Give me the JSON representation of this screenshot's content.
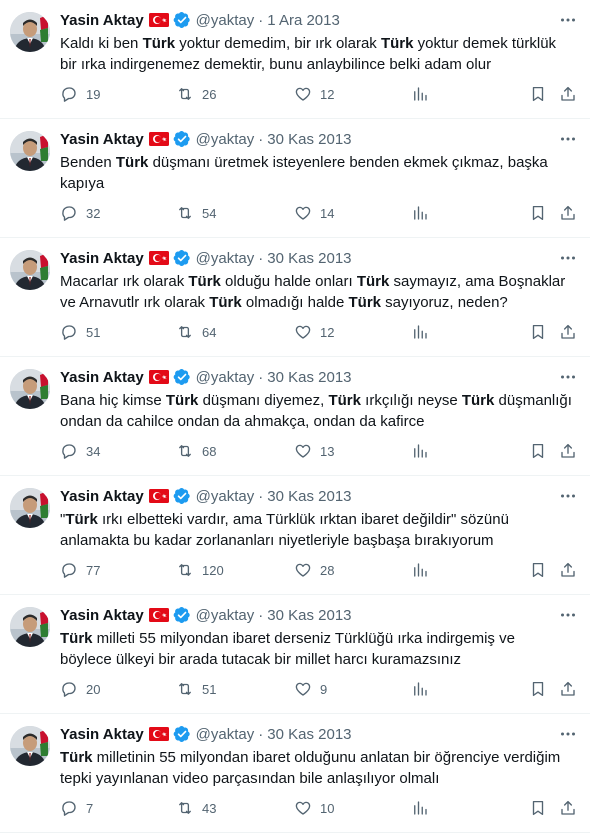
{
  "colors": {
    "text": "#0f1419",
    "secondary": "#536471",
    "verified": "#1d9bf0",
    "flag_red": "#e30a17",
    "divider": "#eff3f4"
  },
  "tweets": [
    {
      "name": "Yasin Aktay",
      "handle": "@yaktay",
      "separator": "·",
      "date": "1 Ara 2013",
      "lines": [
        [
          {
            "t": "Kaldı ki ben ",
            "b": false
          },
          {
            "t": "Türk",
            "b": true
          },
          {
            "t": " yoktur demedim, bir ırk olarak ",
            "b": false
          },
          {
            "t": "Türk",
            "b": true
          },
          {
            "t": " yoktur demek türklük",
            "b": false
          }
        ],
        [
          {
            "t": "bir ırka indirgenemez demektir, bunu anlaybilince belki adam olur",
            "b": false
          }
        ]
      ],
      "replies": "19",
      "reposts": "26",
      "likes": "12"
    },
    {
      "name": "Yasin Aktay",
      "handle": "@yaktay",
      "separator": "·",
      "date": "30 Kas 2013",
      "lines": [
        [
          {
            "t": "Benden ",
            "b": false
          },
          {
            "t": "Türk",
            "b": true
          },
          {
            "t": " düşmanı üretmek isteyenlere benden ekmek çıkmaz, başka",
            "b": false
          }
        ],
        [
          {
            "t": "kapıya",
            "b": false
          }
        ]
      ],
      "replies": "32",
      "reposts": "54",
      "likes": "14"
    },
    {
      "name": "Yasin Aktay",
      "handle": "@yaktay",
      "separator": "·",
      "date": "30 Kas 2013",
      "lines": [
        [
          {
            "t": "Macarlar ırk olarak ",
            "b": false
          },
          {
            "t": "Türk",
            "b": true
          },
          {
            "t": " olduğu halde onları ",
            "b": false
          },
          {
            "t": "Türk",
            "b": true
          },
          {
            "t": " saymayız, ama Boşnaklar",
            "b": false
          }
        ],
        [
          {
            "t": "ve Arnavutlr ırk olarak ",
            "b": false
          },
          {
            "t": "Türk",
            "b": true
          },
          {
            "t": " olmadığı halde ",
            "b": false
          },
          {
            "t": "Türk",
            "b": true
          },
          {
            "t": " sayıyoruz, neden?",
            "b": false
          }
        ]
      ],
      "replies": "51",
      "reposts": "64",
      "likes": "12"
    },
    {
      "name": "Yasin Aktay",
      "handle": "@yaktay",
      "separator": "·",
      "date": "30 Kas 2013",
      "lines": [
        [
          {
            "t": "Bana hiç kimse ",
            "b": false
          },
          {
            "t": "Türk",
            "b": true
          },
          {
            "t": " düşmanı diyemez, ",
            "b": false
          },
          {
            "t": "Türk",
            "b": true
          },
          {
            "t": " ırkçılığı neyse ",
            "b": false
          },
          {
            "t": "Türk",
            "b": true
          },
          {
            "t": " düşmanlığı",
            "b": false
          }
        ],
        [
          {
            "t": "ondan da cahilce ondan da ahmakça, ondan da kafirce",
            "b": false
          }
        ]
      ],
      "replies": "34",
      "reposts": "68",
      "likes": "13"
    },
    {
      "name": "Yasin Aktay",
      "handle": "@yaktay",
      "separator": "·",
      "date": "30 Kas 2013",
      "lines": [
        [
          {
            "t": "\"",
            "b": false
          },
          {
            "t": "Türk",
            "b": true
          },
          {
            "t": " ırkı elbetteki vardır, ama Türklük ırktan ibaret değildir\" sözünü",
            "b": false
          }
        ],
        [
          {
            "t": "anlamakta bu kadar zorlananları niyetleriyle başbaşa bırakıyorum",
            "b": false
          }
        ]
      ],
      "replies": "77",
      "reposts": "120",
      "likes": "28"
    },
    {
      "name": "Yasin Aktay",
      "handle": "@yaktay",
      "separator": "·",
      "date": "30 Kas 2013",
      "lines": [
        [
          {
            "t": "Türk",
            "b": true
          },
          {
            "t": " milleti 55 milyondan ibaret derseniz Türklüğü ırka indirgemiş ve",
            "b": false
          }
        ],
        [
          {
            "t": "böylece ülkeyi bir arada tutacak bir millet harcı kuramazsınız",
            "b": false
          }
        ]
      ],
      "replies": "20",
      "reposts": "51",
      "likes": "9"
    },
    {
      "name": "Yasin Aktay",
      "handle": "@yaktay",
      "separator": "·",
      "date": "30 Kas 2013",
      "lines": [
        [
          {
            "t": "Türk",
            "b": true
          },
          {
            "t": " milletinin 55 milyondan ibaret olduğunu anlatan bir öğrenciye verdiğim",
            "b": false
          }
        ],
        [
          {
            "t": "tepki yayınlanan video parçasından bile anlaşılıyor olmalı",
            "b": false
          }
        ]
      ],
      "replies": "7",
      "reposts": "43",
      "likes": "10"
    }
  ]
}
